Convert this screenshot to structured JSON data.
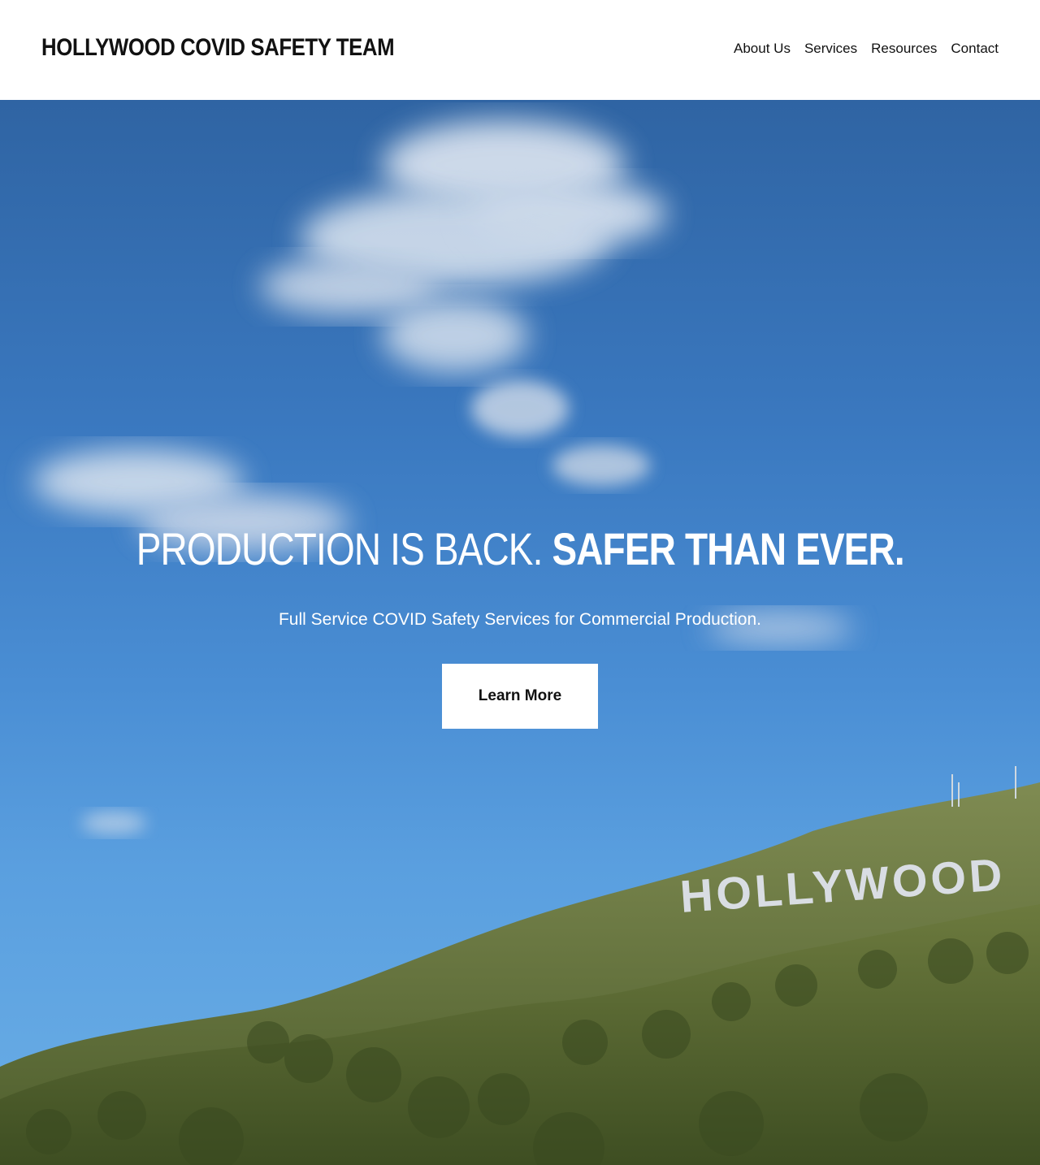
{
  "header": {
    "site_title": "HOLLYWOOD COVID SAFETY TEAM",
    "nav": [
      "About Us",
      "Services",
      "Resources",
      "Contact"
    ]
  },
  "hero": {
    "headline_part1": "PRODUCTION IS BACK.",
    "headline_part2": "SAFER THAN EVER.",
    "subhead": "Full Service COVID Safety Services for Commercial Production.",
    "cta_label": "Learn More",
    "background_image": "Blue sky with clouds over hills and the Hollywood sign",
    "sign_text": "HOLLYWOOD"
  },
  "colors": {
    "header_bg": "#ffffff",
    "title_text": "#111111",
    "sky_top": "#2f64a3",
    "sky_bottom": "#6aaee6",
    "cta_bg": "#ffffff",
    "cta_text": "#111111"
  }
}
